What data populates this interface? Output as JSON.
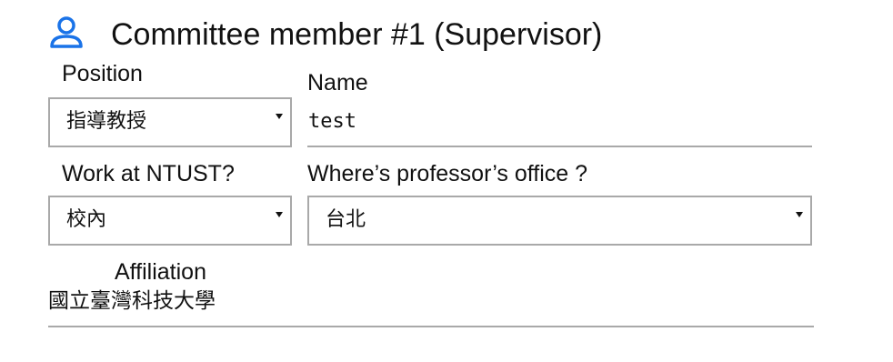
{
  "header": {
    "icon": "user-outline-icon",
    "title": "Committee member #1 (Supervisor)",
    "accent_color": "#1a73e8"
  },
  "form": {
    "position": {
      "label": "Position",
      "value": "指導教授"
    },
    "name": {
      "label": "Name",
      "value": "test"
    },
    "work_at_ntust": {
      "label": "Work at NTUST?",
      "value": "校內"
    },
    "office_location": {
      "label": "Where’s professor’s office ?",
      "value": "台北"
    },
    "affiliation": {
      "label": "Affiliation",
      "value": "國立臺灣科技大學"
    }
  }
}
